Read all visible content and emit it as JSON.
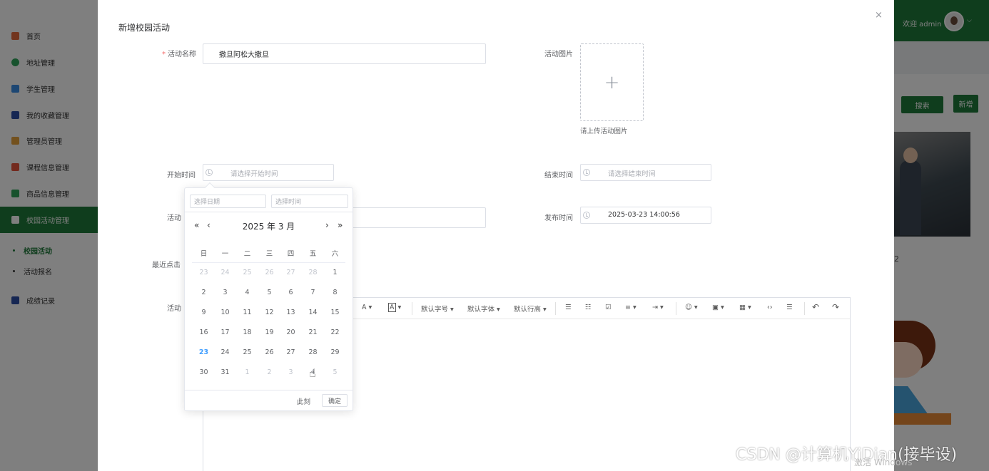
{
  "sidebar": {
    "items": [
      {
        "label": "首页",
        "icon": "home-icon",
        "color": "#e56a3c"
      },
      {
        "label": "地址管理",
        "icon": "location-icon",
        "color": "#2fa55a"
      },
      {
        "label": "学生管理",
        "icon": "user-icon",
        "color": "#3a8ee6"
      },
      {
        "label": "我的收藏管理",
        "icon": "grid-icon",
        "color": "#2d4fa6"
      },
      {
        "label": "管理员管理",
        "icon": "admin-icon",
        "color": "#e6a23c"
      },
      {
        "label": "课程信息管理",
        "icon": "course-icon",
        "color": "#e6553c"
      },
      {
        "label": "商品信息管理",
        "icon": "goods-icon",
        "color": "#2fa55a"
      },
      {
        "label": "校园活动管理",
        "icon": "activity-icon",
        "color": "#4aa6de"
      }
    ],
    "sub_items": [
      {
        "label": "校园活动"
      },
      {
        "label": "活动报名"
      }
    ],
    "extra_item": {
      "label": "成绩记录",
      "icon": "record-icon",
      "color": "#2d4fa6"
    }
  },
  "header": {
    "welcome": "欢迎 admin"
  },
  "page": {
    "search_button": "搜索",
    "add_button": "新增",
    "partial_number": "2"
  },
  "dialog": {
    "title": "新增校园活动",
    "close": "×",
    "fields": {
      "name_label": "活动名称",
      "name_value": "撒旦阿松大撒旦",
      "image_label": "活动图片",
      "image_tip": "请上传活动图片",
      "upload_plus": "+",
      "start_label": "开始时间",
      "start_placeholder": "请选择开始时间",
      "end_label": "结束时间",
      "end_placeholder": "请选择结束时间",
      "location_label": "活动",
      "publish_label": "发布时间",
      "publish_value": "2025-03-23 14:00:56",
      "clicks_label": "最近点击",
      "content_label": "活动"
    },
    "toolbar": {
      "font_color": "A",
      "bg_color": "A",
      "font_size": "默认字号",
      "font_family": "默认字体",
      "line_height": "默认行高"
    }
  },
  "datepicker": {
    "date_placeholder": "选择日期",
    "time_placeholder": "选择时间",
    "year_month": "2025 年  3 月",
    "prev_year": "«",
    "prev_month": "‹",
    "next_month": "›",
    "next_year": "»",
    "weekdays": [
      "日",
      "一",
      "二",
      "三",
      "四",
      "五",
      "六"
    ],
    "weeks": [
      [
        {
          "d": "23",
          "o": true
        },
        {
          "d": "24",
          "o": true
        },
        {
          "d": "25",
          "o": true
        },
        {
          "d": "26",
          "o": true
        },
        {
          "d": "27",
          "o": true
        },
        {
          "d": "28",
          "o": true
        },
        {
          "d": "1",
          "o": false
        }
      ],
      [
        {
          "d": "2",
          "o": false
        },
        {
          "d": "3",
          "o": false
        },
        {
          "d": "4",
          "o": false
        },
        {
          "d": "5",
          "o": false
        },
        {
          "d": "6",
          "o": false
        },
        {
          "d": "7",
          "o": false
        },
        {
          "d": "8",
          "o": false
        }
      ],
      [
        {
          "d": "9",
          "o": false
        },
        {
          "d": "10",
          "o": false
        },
        {
          "d": "11",
          "o": false
        },
        {
          "d": "12",
          "o": false
        },
        {
          "d": "13",
          "o": false
        },
        {
          "d": "14",
          "o": false
        },
        {
          "d": "15",
          "o": false
        }
      ],
      [
        {
          "d": "16",
          "o": false
        },
        {
          "d": "17",
          "o": false
        },
        {
          "d": "18",
          "o": false
        },
        {
          "d": "19",
          "o": false
        },
        {
          "d": "20",
          "o": false
        },
        {
          "d": "21",
          "o": false
        },
        {
          "d": "22",
          "o": false
        }
      ],
      [
        {
          "d": "23",
          "o": false,
          "today": true
        },
        {
          "d": "24",
          "o": false
        },
        {
          "d": "25",
          "o": false
        },
        {
          "d": "26",
          "o": false
        },
        {
          "d": "27",
          "o": false
        },
        {
          "d": "28",
          "o": false
        },
        {
          "d": "29",
          "o": false
        }
      ],
      [
        {
          "d": "30",
          "o": false
        },
        {
          "d": "31",
          "o": false
        },
        {
          "d": "1",
          "o": true
        },
        {
          "d": "2",
          "o": true
        },
        {
          "d": "3",
          "o": true
        },
        {
          "d": "4",
          "o": true
        },
        {
          "d": "5",
          "o": true
        }
      ]
    ],
    "now_button": "此刻",
    "confirm_button": "确定"
  },
  "watermark": "CSDN @计算机YiDian(接毕设)",
  "activate_windows": "激活 Windows"
}
